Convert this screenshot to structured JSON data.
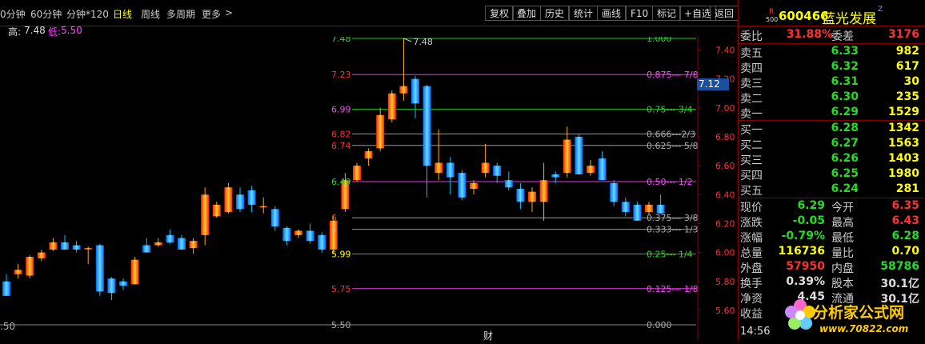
{
  "toolbar": {
    "left_tabs": [
      "0分钟",
      "60分钟",
      "分钟*120",
      "日线",
      "周线",
      "多周期",
      "更多"
    ],
    "more_arrow": ">",
    "buttons": [
      "复权",
      "叠加",
      "历史",
      "统计",
      "画线",
      "F10",
      "标记",
      "+自选",
      "返回"
    ]
  },
  "hilo": {
    "high_label": "高:",
    "high_value": "7.48",
    "low_label": "低:",
    "low_value": "5.50"
  },
  "colors": {
    "up": "#ff3030",
    "down": "#00c8ff",
    "accent": "#ffff00",
    "border": "#800000",
    "magenta": "#ff44ff",
    "green": "#22dd22"
  },
  "main_chart": {
    "left_ticks": [
      {
        "label": "7.48",
        "value": 7.48,
        "color": "#22dd22"
      },
      {
        "label": "7.23",
        "value": 7.23,
        "color": "#ff3030"
      },
      {
        "label": "6.99",
        "value": 6.99,
        "color": "#ff44ff"
      },
      {
        "label": "6.82",
        "value": 6.82,
        "color": "#ff3030"
      },
      {
        "label": "6.74",
        "value": 6.74,
        "color": "#ff3030"
      },
      {
        "label": "6.49",
        "value": 6.49,
        "color": "#22dd22"
      },
      {
        "label": "6",
        "value": 6.24,
        "color": "#ff3030"
      },
      {
        "label": "6",
        "value": 6.16,
        "color": "#aaaaaa"
      },
      {
        "label": "5.99",
        "value": 5.99,
        "color": "#ffff00"
      },
      {
        "label": "5.75",
        "value": 5.75,
        "color": "#ff3030"
      },
      {
        "label": "5.50",
        "value": 5.5,
        "color": "#aaaaaa"
      }
    ],
    "fib_levels": [
      {
        "value": 7.48,
        "label": "1.000",
        "color": "#22dd22"
      },
      {
        "value": 7.23,
        "label": "0.875--- 7/8",
        "color": "#ff44ff"
      },
      {
        "value": 6.99,
        "label": "0.75--- 3/4",
        "color": "#22dd22"
      },
      {
        "value": 6.82,
        "label": "0.666---2/3",
        "color": "#aaaaaa"
      },
      {
        "value": 6.74,
        "label": "0.625--- 5/8",
        "color": "#aaaaaa"
      },
      {
        "value": 6.49,
        "label": "0.50--- 1/2",
        "color": "#ff44ff"
      },
      {
        "value": 6.24,
        "label": "0.375--- 3/8",
        "color": "#aaaaaa"
      },
      {
        "value": 6.16,
        "label": "0.333--- 1/3",
        "color": "#aaaaaa"
      },
      {
        "value": 5.99,
        "label": "0.25--- 1/4",
        "color": "#22dd22"
      },
      {
        "value": 5.75,
        "label": "0.125--- 1/8",
        "color": "#ff44ff"
      },
      {
        "value": 5.5,
        "label": "0.000",
        "color": "#aaaaaa"
      }
    ],
    "right_axis": [
      "7.40",
      "7.20",
      "7.00",
      "6.80",
      "6.60",
      "6.40",
      "6.20",
      "6.00",
      "5.80",
      "5.60"
    ],
    "current_price_tag": "7.12",
    "peak_label": "7.48",
    "bottom_left_label": ".50",
    "bottom_marker": "财"
  },
  "chart_data": {
    "type": "candlestick",
    "ylim": [
      5.5,
      7.48
    ],
    "candles": [
      {
        "o": 5.8,
        "h": 5.85,
        "l": 5.7,
        "c": 5.7
      },
      {
        "o": 5.85,
        "h": 5.92,
        "l": 5.82,
        "c": 5.88
      },
      {
        "o": 5.84,
        "h": 5.98,
        "l": 5.82,
        "c": 5.97
      },
      {
        "o": 5.96,
        "h": 6.02,
        "l": 5.94,
        "c": 6.0
      },
      {
        "o": 6.02,
        "h": 6.1,
        "l": 6.01,
        "c": 6.07
      },
      {
        "o": 6.07,
        "h": 6.12,
        "l": 6.02,
        "c": 6.02
      },
      {
        "o": 6.05,
        "h": 6.08,
        "l": 6.0,
        "c": 6.02
      },
      {
        "o": 6.03,
        "h": 6.04,
        "l": 5.92,
        "c": 6.03
      },
      {
        "o": 6.05,
        "h": 6.06,
        "l": 5.7,
        "c": 5.73
      },
      {
        "o": 5.82,
        "h": 5.83,
        "l": 5.67,
        "c": 5.72
      },
      {
        "o": 5.8,
        "h": 5.82,
        "l": 5.74,
        "c": 5.77
      },
      {
        "o": 5.78,
        "h": 5.97,
        "l": 5.78,
        "c": 5.95
      },
      {
        "o": 6.05,
        "h": 6.1,
        "l": 6.0,
        "c": 6.0
      },
      {
        "o": 6.05,
        "h": 6.1,
        "l": 6.04,
        "c": 6.07
      },
      {
        "o": 6.12,
        "h": 6.16,
        "l": 6.06,
        "c": 6.07
      },
      {
        "o": 6.1,
        "h": 6.12,
        "l": 6.02,
        "c": 6.02
      },
      {
        "o": 6.03,
        "h": 6.1,
        "l": 5.99,
        "c": 6.08
      },
      {
        "o": 6.12,
        "h": 6.45,
        "l": 6.05,
        "c": 6.4
      },
      {
        "o": 6.25,
        "h": 6.35,
        "l": 6.24,
        "c": 6.33
      },
      {
        "o": 6.28,
        "h": 6.48,
        "l": 6.27,
        "c": 6.45
      },
      {
        "o": 6.4,
        "h": 6.45,
        "l": 6.28,
        "c": 6.3
      },
      {
        "o": 6.43,
        "h": 6.46,
        "l": 6.28,
        "c": 6.33
      },
      {
        "o": 6.32,
        "h": 6.38,
        "l": 6.27,
        "c": 6.32
      },
      {
        "o": 6.3,
        "h": 6.32,
        "l": 6.15,
        "c": 6.18
      },
      {
        "o": 6.17,
        "h": 6.18,
        "l": 6.05,
        "c": 6.08
      },
      {
        "o": 6.12,
        "h": 6.16,
        "l": 6.1,
        "c": 6.15
      },
      {
        "o": 6.15,
        "h": 6.2,
        "l": 6.06,
        "c": 6.08
      },
      {
        "o": 6.12,
        "h": 6.14,
        "l": 6.0,
        "c": 6.02
      },
      {
        "o": 6.02,
        "h": 6.26,
        "l": 5.99,
        "c": 6.22
      },
      {
        "o": 6.3,
        "h": 6.55,
        "l": 6.28,
        "c": 6.5
      },
      {
        "o": 6.5,
        "h": 6.62,
        "l": 6.49,
        "c": 6.6
      },
      {
        "o": 6.65,
        "h": 6.72,
        "l": 6.6,
        "c": 6.7
      },
      {
        "o": 6.72,
        "h": 7.0,
        "l": 6.7,
        "c": 6.95
      },
      {
        "o": 6.92,
        "h": 7.12,
        "l": 6.9,
        "c": 7.1
      },
      {
        "o": 7.1,
        "h": 7.48,
        "l": 7.05,
        "c": 7.15
      },
      {
        "o": 7.2,
        "h": 7.22,
        "l": 6.93,
        "c": 7.03
      },
      {
        "o": 7.15,
        "h": 7.16,
        "l": 6.38,
        "c": 6.6
      },
      {
        "o": 6.55,
        "h": 6.85,
        "l": 6.5,
        "c": 6.62
      },
      {
        "o": 6.62,
        "h": 6.66,
        "l": 6.4,
        "c": 6.52
      },
      {
        "o": 6.55,
        "h": 6.57,
        "l": 6.36,
        "c": 6.38
      },
      {
        "o": 6.44,
        "h": 6.5,
        "l": 6.4,
        "c": 6.48
      },
      {
        "o": 6.55,
        "h": 6.75,
        "l": 6.52,
        "c": 6.62
      },
      {
        "o": 6.6,
        "h": 6.62,
        "l": 6.48,
        "c": 6.53
      },
      {
        "o": 6.5,
        "h": 6.56,
        "l": 6.43,
        "c": 6.45
      },
      {
        "o": 6.44,
        "h": 6.48,
        "l": 6.3,
        "c": 6.35
      },
      {
        "o": 6.35,
        "h": 6.45,
        "l": 6.28,
        "c": 6.42
      },
      {
        "o": 6.35,
        "h": 6.62,
        "l": 6.22,
        "c": 6.5
      },
      {
        "o": 6.54,
        "h": 6.56,
        "l": 6.48,
        "c": 6.52
      },
      {
        "o": 6.55,
        "h": 6.87,
        "l": 6.52,
        "c": 6.78
      },
      {
        "o": 6.8,
        "h": 6.82,
        "l": 6.55,
        "c": 6.54
      },
      {
        "o": 6.55,
        "h": 6.64,
        "l": 6.53,
        "c": 6.6
      },
      {
        "o": 6.65,
        "h": 6.7,
        "l": 6.5,
        "c": 6.5
      },
      {
        "o": 6.48,
        "h": 6.5,
        "l": 6.32,
        "c": 6.35
      },
      {
        "o": 6.35,
        "h": 6.38,
        "l": 6.25,
        "c": 6.28
      },
      {
        "o": 6.33,
        "h": 6.35,
        "l": 6.22,
        "c": 6.22
      },
      {
        "o": 6.28,
        "h": 6.35,
        "l": 6.26,
        "c": 6.33
      },
      {
        "o": 6.33,
        "h": 6.4,
        "l": 6.27,
        "c": 6.27
      }
    ]
  },
  "quote": {
    "r_mark": "R",
    "r_sub": "500",
    "code": "600466",
    "name": "蓝光发展",
    "z_mark": "Z",
    "weibi_label": "委比",
    "weibi_value": "31.88%",
    "weicha_label": "委差",
    "weicha_value": "3176",
    "asks": [
      {
        "label": "卖五",
        "price": "6.33",
        "vol": "982"
      },
      {
        "label": "卖四",
        "price": "6.32",
        "vol": "617"
      },
      {
        "label": "卖三",
        "price": "6.31",
        "vol": "30"
      },
      {
        "label": "卖二",
        "price": "6.30",
        "vol": "235"
      },
      {
        "label": "卖一",
        "price": "6.29",
        "vol": "1529"
      }
    ],
    "bids": [
      {
        "label": "买一",
        "price": "6.28",
        "vol": "1342"
      },
      {
        "label": "买二",
        "price": "6.27",
        "vol": "1563"
      },
      {
        "label": "买三",
        "price": "6.26",
        "vol": "1403"
      },
      {
        "label": "买四",
        "price": "6.25",
        "vol": "1980"
      },
      {
        "label": "买五",
        "price": "6.24",
        "vol": "281"
      }
    ],
    "stats": [
      {
        "l1": "现价",
        "v1": "6.29",
        "c1": "#22dd22",
        "l2": "今开",
        "v2": "6.35",
        "c2": "#ff3030"
      },
      {
        "l1": "涨跌",
        "v1": "-0.05",
        "c1": "#22dd22",
        "l2": "最高",
        "v2": "6.43",
        "c2": "#ff3030"
      },
      {
        "l1": "涨幅",
        "v1": "-0.79%",
        "c1": "#22dd22",
        "l2": "最低",
        "v2": "6.28",
        "c2": "#22dd22"
      },
      {
        "l1": "总量",
        "v1": "116736",
        "c1": "#ffff00",
        "l2": "量比",
        "v2": "0.70",
        "c2": "#ffff00"
      },
      {
        "l1": "外盘",
        "v1": "57950",
        "c1": "#ff3030",
        "l2": "内盘",
        "v2": "58786",
        "c2": "#22dd22"
      },
      {
        "l1": "换手",
        "v1": "0.39%",
        "c1": "#dddddd",
        "l2": "股本",
        "v2": "30.1亿",
        "c2": "#dddddd"
      },
      {
        "l1": "净资",
        "v1": "4.45",
        "c1": "#dddddd",
        "l2": "流通",
        "v2": "30.1亿",
        "c2": "#dddddd"
      },
      {
        "l1": "收益",
        "v1": "",
        "c1": "#dddddd",
        "l2": "",
        "v2": "",
        "c2": "#dddddd"
      }
    ],
    "time": "14:56"
  },
  "watermark": {
    "title": "分析家公式网",
    "url": "www.70822.com"
  }
}
